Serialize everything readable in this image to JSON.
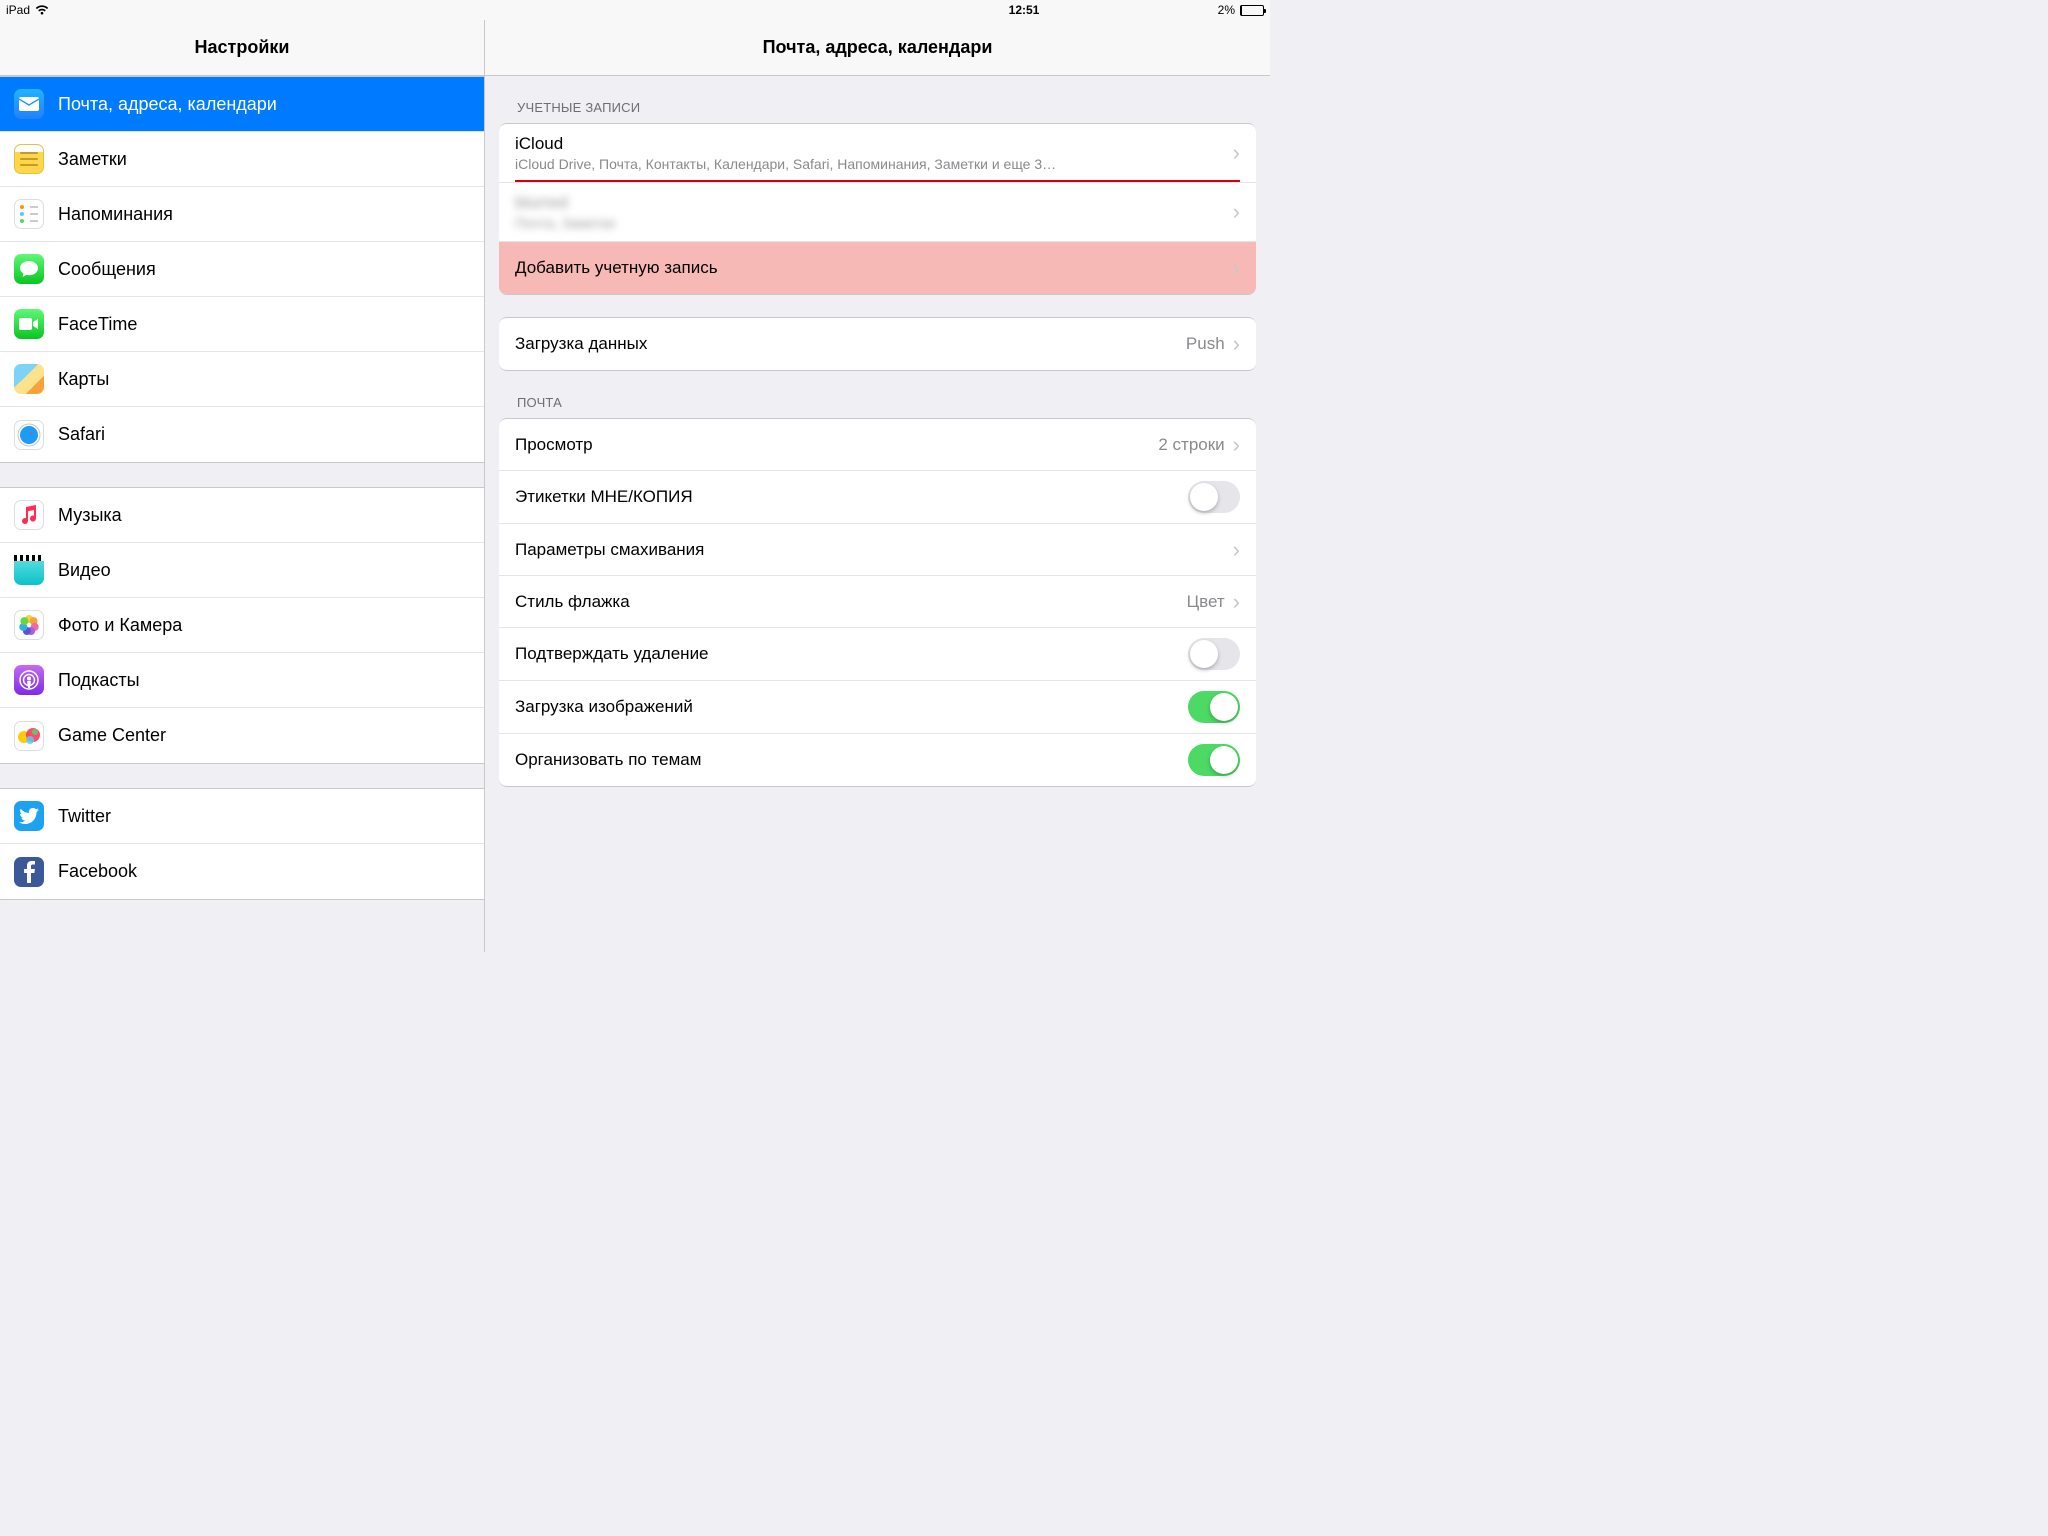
{
  "statusbar": {
    "device": "iPad",
    "time": "12:51",
    "battery_text": "2%",
    "battery_pct": 2
  },
  "sidebar": {
    "title": "Настройки",
    "groups": [
      {
        "items": [
          {
            "id": "mail",
            "label": "Почта, адреса, календари",
            "icon": "ic-mail",
            "selected": true
          },
          {
            "id": "notes",
            "label": "Заметки",
            "icon": "ic-notes",
            "selected": false
          },
          {
            "id": "reminders",
            "label": "Напоминания",
            "icon": "ic-remind",
            "selected": false
          },
          {
            "id": "messages",
            "label": "Сообщения",
            "icon": "ic-msg",
            "selected": false
          },
          {
            "id": "facetime",
            "label": "FaceTime",
            "icon": "ic-facetime",
            "selected": false
          },
          {
            "id": "maps",
            "label": "Карты",
            "icon": "ic-maps",
            "selected": false
          },
          {
            "id": "safari",
            "label": "Safari",
            "icon": "ic-safari",
            "selected": false
          }
        ]
      },
      {
        "items": [
          {
            "id": "music",
            "label": "Музыка",
            "icon": "ic-music",
            "selected": false
          },
          {
            "id": "video",
            "label": "Видео",
            "icon": "ic-video",
            "selected": false
          },
          {
            "id": "photos",
            "label": "Фото и Камера",
            "icon": "ic-photo",
            "selected": false
          },
          {
            "id": "podcasts",
            "label": "Подкасты",
            "icon": "ic-podcast",
            "selected": false
          },
          {
            "id": "gamecenter",
            "label": "Game Center",
            "icon": "ic-gamec",
            "selected": false
          }
        ]
      },
      {
        "items": [
          {
            "id": "twitter",
            "label": "Twitter",
            "icon": "ic-tw",
            "selected": false
          },
          {
            "id": "facebook",
            "label": "Facebook",
            "icon": "ic-fb",
            "selected": false
          }
        ]
      }
    ]
  },
  "detail": {
    "title": "Почта, адреса, календари",
    "sections": [
      {
        "label": "УЧЕТНЫЕ ЗАПИСИ",
        "rows": [
          {
            "id": "icloud",
            "type": "account",
            "title": "iCloud",
            "sub": "iCloud Drive, Почта, Контакты, Календари, Safari, Напоминания, Заметки и еще 3…",
            "redline": true
          },
          {
            "id": "acct2",
            "type": "account",
            "title": "blurred",
            "sub": "Почта, Заметки",
            "blurred": true
          },
          {
            "id": "add",
            "type": "link",
            "title": "Добавить учетную запись",
            "highlight": true
          }
        ]
      },
      {
        "rows": [
          {
            "id": "fetch",
            "type": "nav",
            "title": "Загрузка данных",
            "value": "Push"
          }
        ]
      },
      {
        "label": "ПОЧТА",
        "rows": [
          {
            "id": "preview",
            "type": "nav",
            "title": "Просмотр",
            "value": "2 строки"
          },
          {
            "id": "tocc",
            "type": "toggle",
            "title": "Этикетки МНЕ/КОПИЯ",
            "on": false
          },
          {
            "id": "swipe",
            "type": "nav",
            "title": "Параметры смахивания"
          },
          {
            "id": "flag",
            "type": "nav",
            "title": "Стиль флажка",
            "value": "Цвет"
          },
          {
            "id": "confirm",
            "type": "toggle",
            "title": "Подтверждать удаление",
            "on": false
          },
          {
            "id": "images",
            "type": "toggle",
            "title": "Загрузка изображений",
            "on": true
          },
          {
            "id": "threads",
            "type": "toggle",
            "title": "Организовать по темам",
            "on": true
          }
        ]
      }
    ]
  }
}
